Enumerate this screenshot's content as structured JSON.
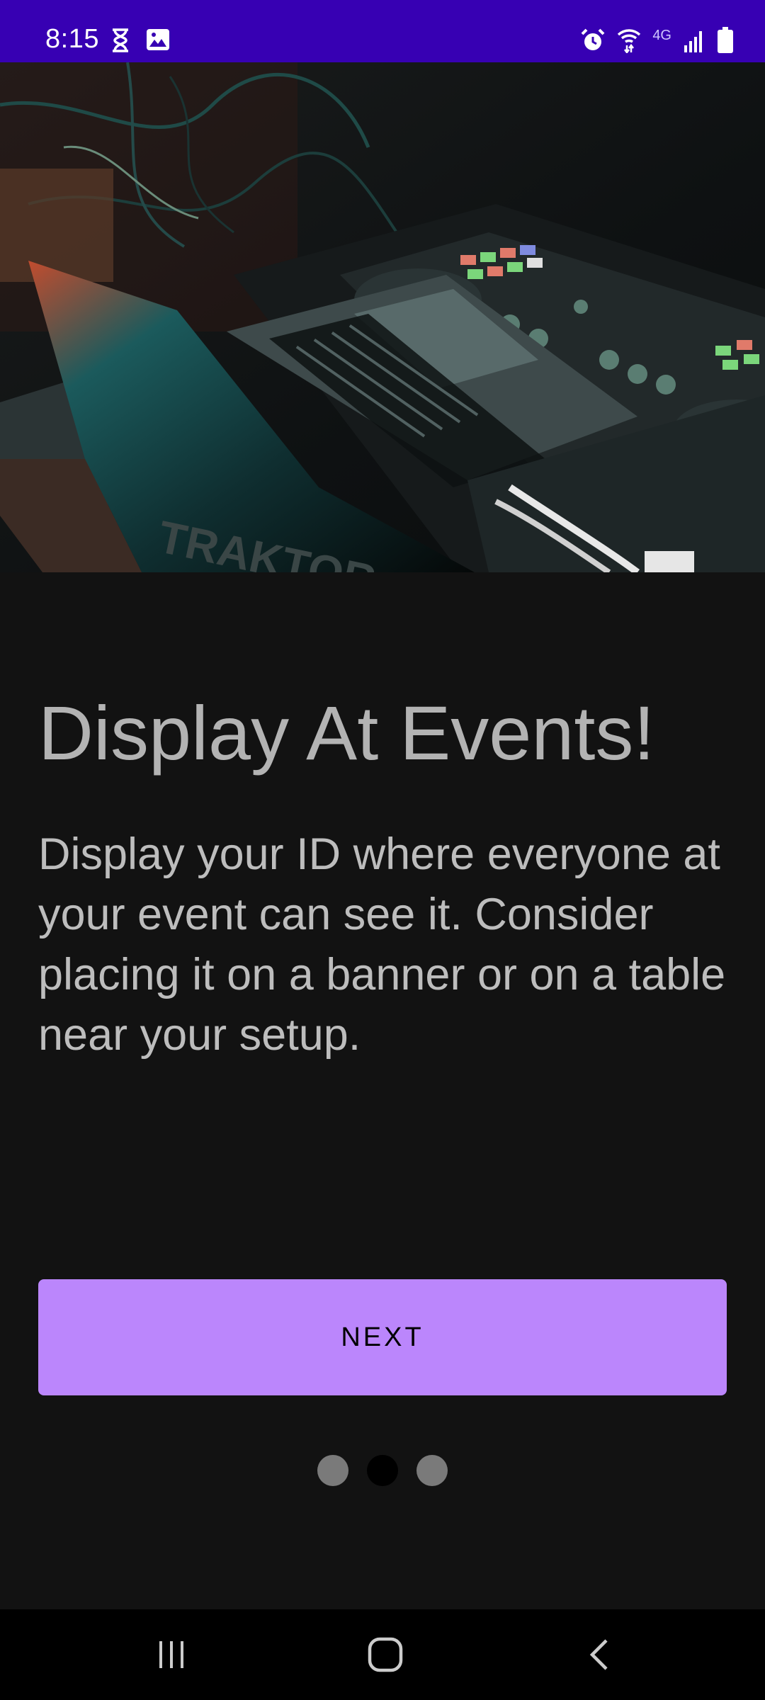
{
  "status_bar": {
    "time": "8:15",
    "left_icons": [
      "hourglass-icon",
      "image-icon"
    ],
    "right_icons": [
      "alarm-icon",
      "wifi-icon",
      "4g-icon",
      "signal-icon",
      "battery-icon"
    ],
    "network_label": "4G",
    "background": "#3700b3"
  },
  "hero_image": {
    "alt": "DJ laptop and controller"
  },
  "onboarding": {
    "title": "Display At Events!",
    "description": "Display your ID where everyone at your event can see it. Consider placing it on a banner or on a table near your setup.",
    "next_label": "NEXT",
    "pages": 3,
    "current_page": 2
  },
  "colors": {
    "background": "#121212",
    "accent": "#bb86fc",
    "text": "#b3b3b3"
  },
  "nav_bar": {
    "buttons": [
      "recents-icon",
      "home-icon",
      "back-icon"
    ]
  }
}
